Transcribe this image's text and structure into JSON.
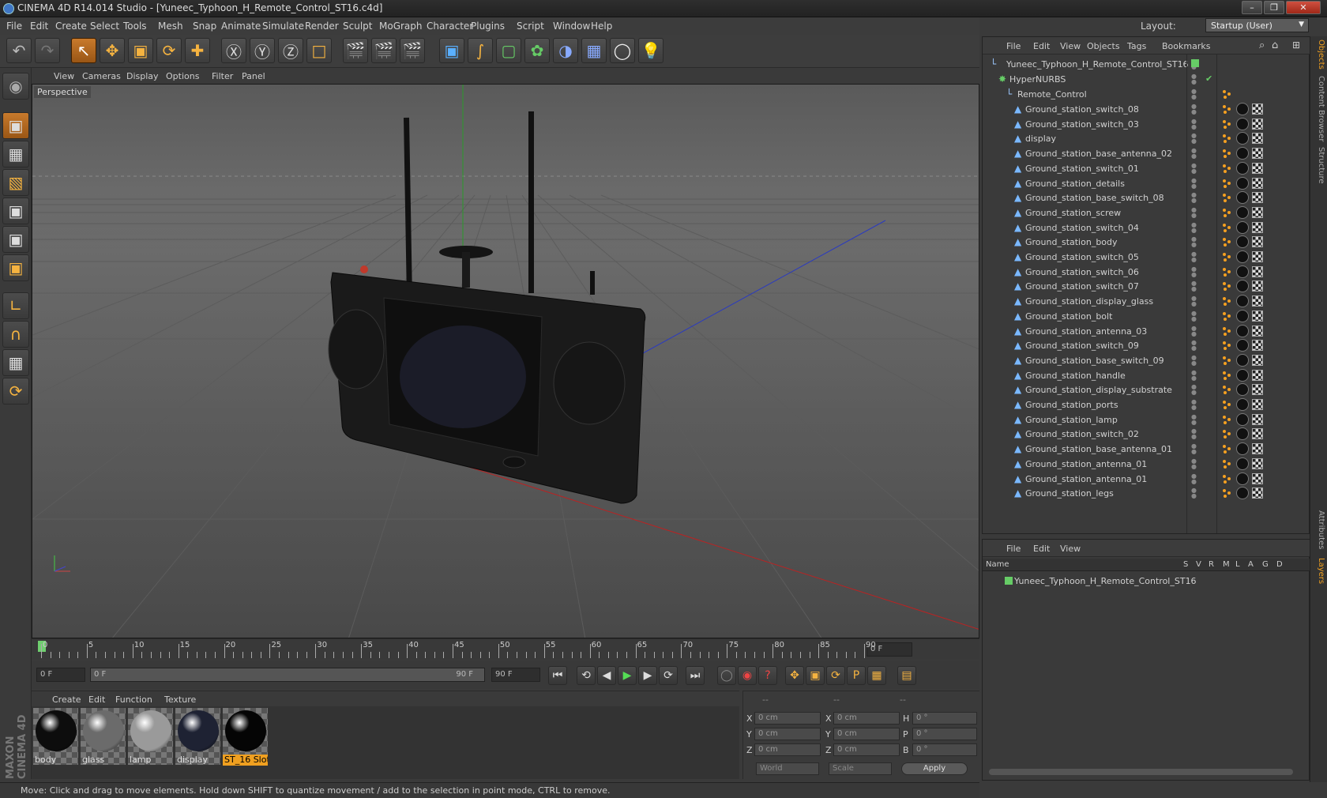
{
  "window": {
    "title": "CINEMA 4D R14.014 Studio - [Yuneec_Typhoon_H_Remote_Control_ST16.c4d]"
  },
  "menu": [
    "File",
    "Edit",
    "Create",
    "Select",
    "Tools",
    "Mesh",
    "Snap",
    "Animate",
    "Simulate",
    "Render",
    "Sculpt",
    "MoGraph",
    "Character",
    "Plugins",
    "Script",
    "Window",
    "Help"
  ],
  "layout": {
    "label": "Layout:",
    "value": "Startup (User)"
  },
  "viewport": {
    "menu": [
      "View",
      "Cameras",
      "Display",
      "Options",
      "Filter",
      "Panel"
    ],
    "label": "Perspective"
  },
  "timeline": {
    "ticks": [
      "0",
      "5",
      "10",
      "15",
      "20",
      "25",
      "30",
      "35",
      "40",
      "45",
      "50",
      "55",
      "60",
      "65",
      "70",
      "75",
      "80",
      "85",
      "90"
    ],
    "current_frame": "0 F"
  },
  "controls": {
    "start": "0 F",
    "range_start": "0 F",
    "range_end": "90 F",
    "end": "90 F"
  },
  "materials": {
    "menu": [
      "Create",
      "Edit",
      "Function",
      "Texture"
    ],
    "items": [
      {
        "name": "body",
        "color": "#0d0d0d"
      },
      {
        "name": "glass",
        "color": "#6b6b6b"
      },
      {
        "name": "lamp",
        "color": "#9a9a9a"
      },
      {
        "name": "display",
        "color": "#1e2233"
      },
      {
        "name": "ST_16 Slot",
        "color": "#050505",
        "selected": true
      }
    ]
  },
  "coords": {
    "headers": [
      "--",
      "--",
      "--"
    ],
    "rows": [
      {
        "a": "X",
        "av": "0 cm",
        "b": "X",
        "bv": "0 cm",
        "c": "H",
        "cv": "0 °"
      },
      {
        "a": "Y",
        "av": "0 cm",
        "b": "Y",
        "bv": "0 cm",
        "c": "P",
        "cv": "0 °"
      },
      {
        "a": "Z",
        "av": "0 cm",
        "b": "Z",
        "bv": "0 cm",
        "c": "B",
        "cv": "0 °"
      }
    ],
    "mode1": "World",
    "mode2": "Scale",
    "apply": "Apply"
  },
  "status": "Move: Click and drag to move elements. Hold down SHIFT to quantize movement / add to the selection in point mode, CTRL to remove.",
  "objects": {
    "menu": [
      "File",
      "Edit",
      "View",
      "Objects",
      "Tags",
      "Bookmarks"
    ],
    "root": "Yuneec_Typhoon_H_Remote_Control_ST16",
    "hypernurbs": "HyperNURBS",
    "group": "Remote_Control",
    "items": [
      "Ground_station_switch_08",
      "Ground_station_switch_03",
      "display",
      "Ground_station_base_antenna_02",
      "Ground_station_switch_01",
      "Ground_station_details",
      "Ground_station_base_switch_08",
      "Ground_station_screw",
      "Ground_station_switch_04",
      "Ground_station_body",
      "Ground_station_switch_05",
      "Ground_station_switch_06",
      "Ground_station_switch_07",
      "Ground_station_display_glass",
      "Ground_station_bolt",
      "Ground_station_antenna_03",
      "Ground_station_switch_09",
      "Ground_station_base_switch_09",
      "Ground_station_handle",
      "Ground_station_display_substrate",
      "Ground_station_ports",
      "Ground_station_lamp",
      "Ground_station_switch_02",
      "Ground_station_base_antenna_01",
      "Ground_station_antenna_01",
      "Ground_station_antenna_01",
      "Ground_station_legs"
    ]
  },
  "layers": {
    "menu": [
      "File",
      "Edit",
      "View"
    ],
    "columns": [
      "Name",
      "S",
      "V",
      "R",
      "M",
      "L",
      "A",
      "G",
      "D"
    ],
    "item": "Yuneec_Typhoon_H_Remote_Control_ST16"
  },
  "side_tabs": [
    "Objects",
    "Content Browser",
    "Structure",
    "Attributes",
    "Layers"
  ],
  "brand": "MAXON CINEMA 4D"
}
